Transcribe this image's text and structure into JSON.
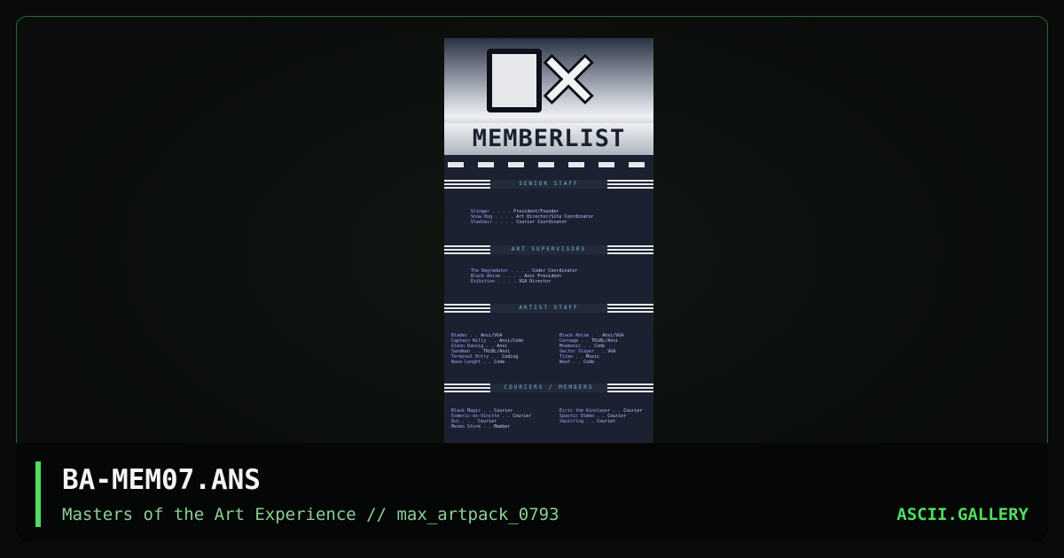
{
  "artwork": {
    "wordmark": "MEMBERLIST",
    "sections": [
      {
        "label": "SENIOR STAFF"
      },
      {
        "label": "ART SUPERVISORS"
      },
      {
        "label": "ARTIST STAFF"
      },
      {
        "label": "COURIERS / MEMBERS"
      }
    ],
    "senior_staff": [
      {
        "name": "Slinger",
        "role": "President/Founder"
      },
      {
        "name": "Snow Dog",
        "role": "Art Director/Site Coordinator"
      },
      {
        "name": "Vladimir",
        "role": "Courier Coordinator"
      }
    ],
    "art_supervisors": [
      {
        "name": "The Degradator",
        "role": "Coder Coordinator"
      },
      {
        "name": "Black Abism",
        "role": "Ansi President"
      },
      {
        "name": "Exibition",
        "role": "VGA Director"
      }
    ],
    "artist_staff_left": [
      {
        "name": "Blades",
        "role": "Ansi/VGA"
      },
      {
        "name": "Captain Willy",
        "role": "Ansi/Code"
      },
      {
        "name": "Glenn Danzig",
        "role": "Ansi"
      },
      {
        "name": "Sandman",
        "role": "TRiBL/Ansi"
      },
      {
        "name": "Terminal Entry",
        "role": "Coding"
      },
      {
        "name": "Wave Lenght",
        "role": "Code"
      }
    ],
    "artist_staff_right": [
      {
        "name": "Black Abism",
        "role": "Ansi/VGA"
      },
      {
        "name": "Carnage",
        "role": "TRiBL/Ansi"
      },
      {
        "name": "Mnemonic",
        "role": "Code"
      },
      {
        "name": "Sector Slayer",
        "role": "VGA"
      },
      {
        "name": "Titan",
        "role": "Music"
      },
      {
        "name": "Weaf",
        "role": "Code"
      }
    ],
    "couriers_left": [
      {
        "name": "Black Magic",
        "role": "Courier"
      },
      {
        "name": "Esmeric-ex-Vinitte",
        "role": "Courier"
      },
      {
        "name": "Dur..",
        "role": "Courier"
      },
      {
        "name": "Mezmo Storm",
        "role": "Member"
      }
    ],
    "couriers_right": [
      {
        "name": "Eiric the Kinslayer",
        "role": "Courier"
      },
      {
        "name": "Spastic Dimbo",
        "role": "Courier"
      },
      {
        "name": "Squirrlog",
        "role": "Courier"
      }
    ]
  },
  "caption": {
    "title": "BA-MEM07.ANS",
    "subtitle": "Masters of the Art Experience // max_artpack_0793",
    "brand": "ASCII.GALLERY"
  },
  "colors": {
    "accent": "#4fdd62",
    "frame_border": "#2a6a34",
    "art_background": "#1b2130"
  }
}
